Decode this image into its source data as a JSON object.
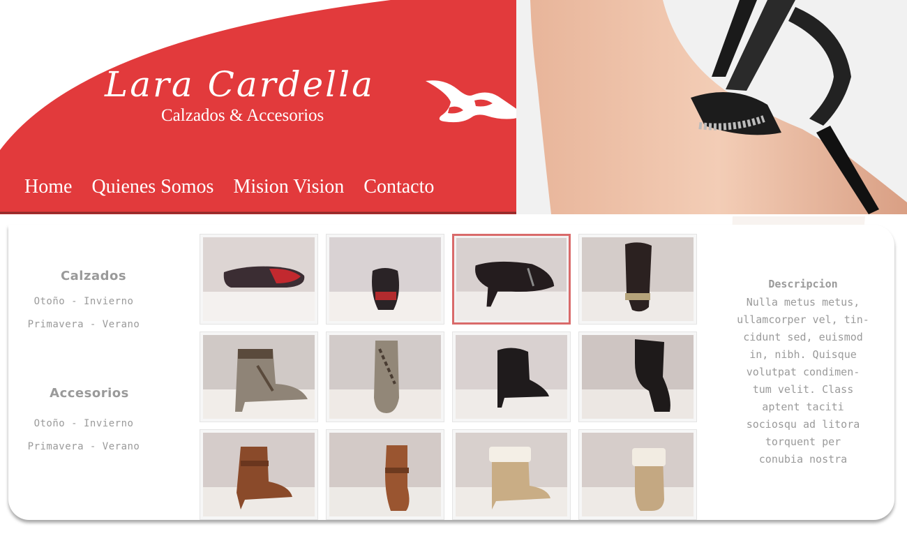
{
  "brand": {
    "title": "Lara Cardella",
    "subtitle": "Calzados & Accesorios",
    "accent_color": "#e23a3c",
    "logo_icon": "stylized-shoe-logo"
  },
  "nav": {
    "items": [
      "Home",
      "Quienes Somos",
      "Mision Vision",
      "Contacto"
    ]
  },
  "sidebar": {
    "sections": [
      {
        "title": "Calzados",
        "links": [
          "Otoño - Invierno",
          "Primavera - Verano"
        ]
      },
      {
        "title": "Accesorios",
        "links": [
          "Otoño - Invierno",
          "Primavera - Verano"
        ]
      }
    ]
  },
  "gallery": {
    "selected_index": 2,
    "products": [
      {
        "image": "black-red-ballet-flat"
      },
      {
        "image": "black-red-ballet-flat-front"
      },
      {
        "image": "black-suede-heel-pump"
      },
      {
        "image": "black-fringe-heel-pump"
      },
      {
        "image": "taupe-lace-up-ankle-boot"
      },
      {
        "image": "taupe-lace-up-ankle-boot-front"
      },
      {
        "image": "black-leather-heel-bootie"
      },
      {
        "image": "black-leather-bootie-side"
      },
      {
        "image": "brown-wedge-ankle-boot"
      },
      {
        "image": "brown-wedge-ankle-boot-side"
      },
      {
        "image": "beige-fur-trim-wedge-boot"
      },
      {
        "image": "beige-fur-trim-wedge-boot-side"
      }
    ]
  },
  "description": {
    "title": "Descripcion",
    "lines": [
      "Nulla metus metus,",
      "ullamcorper vel, tin-",
      "cidunt sed, euismod",
      "in, nibh. Quisque",
      "volutpat condimen-",
      "tum velit. Class",
      "aptent taciti",
      "sociosqu ad litora",
      "torquent per",
      "conubia nostra"
    ]
  }
}
